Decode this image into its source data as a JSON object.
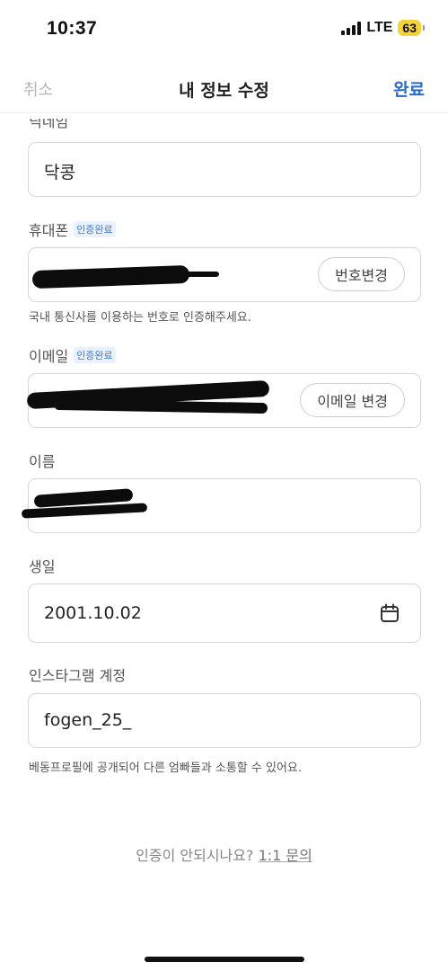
{
  "status_bar": {
    "time": "10:37",
    "network": "LTE",
    "battery": "63"
  },
  "nav": {
    "cancel": "취소",
    "title": "내 정보 수정",
    "done": "완료"
  },
  "fields": {
    "nickname": {
      "label": "닉네임",
      "value": "닥콩"
    },
    "phone": {
      "label": "휴대폰",
      "badge": "인증완료",
      "button": "번호변경",
      "helper": "국내 통신사를 이용하는 번호로 인증해주세요."
    },
    "email": {
      "label": "이메일",
      "badge": "인증완료",
      "button": "이메일 변경"
    },
    "name": {
      "label": "이름"
    },
    "birthday": {
      "label": "생일",
      "value": "2001.10.02"
    },
    "instagram": {
      "label": "인스타그램 계정",
      "value": "fogen_25_",
      "helper": "베동프로필에 공개되어 다른 엄빠들과 소통할 수 있어요."
    }
  },
  "footer": {
    "question": "인증이 안되시나요?",
    "link": "1:1 문의"
  }
}
